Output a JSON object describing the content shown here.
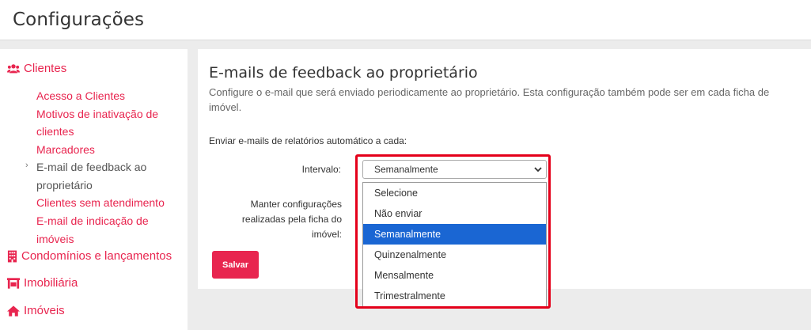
{
  "header": {
    "title": "Configurações"
  },
  "sidebar": {
    "sections": {
      "clientes": "Clientes",
      "condominios": "Condomínios e lançamentos",
      "imobiliaria": "Imobiliária",
      "imoveis": "Imóveis"
    },
    "items": [
      "Acesso a Clientes",
      "Motivos de inativação de",
      "clientes",
      "Marcadores",
      "E-mail de feedback ao",
      "proprietário",
      "Clientes sem atendimento",
      "E-mail de indicação de imóveis"
    ]
  },
  "main": {
    "title": "E-mails de feedback ao proprietário",
    "description": "Configure o e-mail que será enviado periodicamente ao proprietário. Esta configuração também pode ser em cada ficha de imóvel.",
    "send_label": "Enviar e-mails de relatórios automático a cada:",
    "interval_label": "Intervalo:",
    "keep_label": "Manter configurações realizadas pela ficha do imóvel:",
    "save_label": "Salvar",
    "select_value": "Semanalmente",
    "options": [
      "Selecione",
      "Não enviar",
      "Semanalmente",
      "Quinzenalmente",
      "Mensalmente",
      "Trimestralmente"
    ]
  },
  "colors": {
    "accent": "#e8254f",
    "selected": "#1a66d3",
    "highlight": "#e4001a"
  }
}
